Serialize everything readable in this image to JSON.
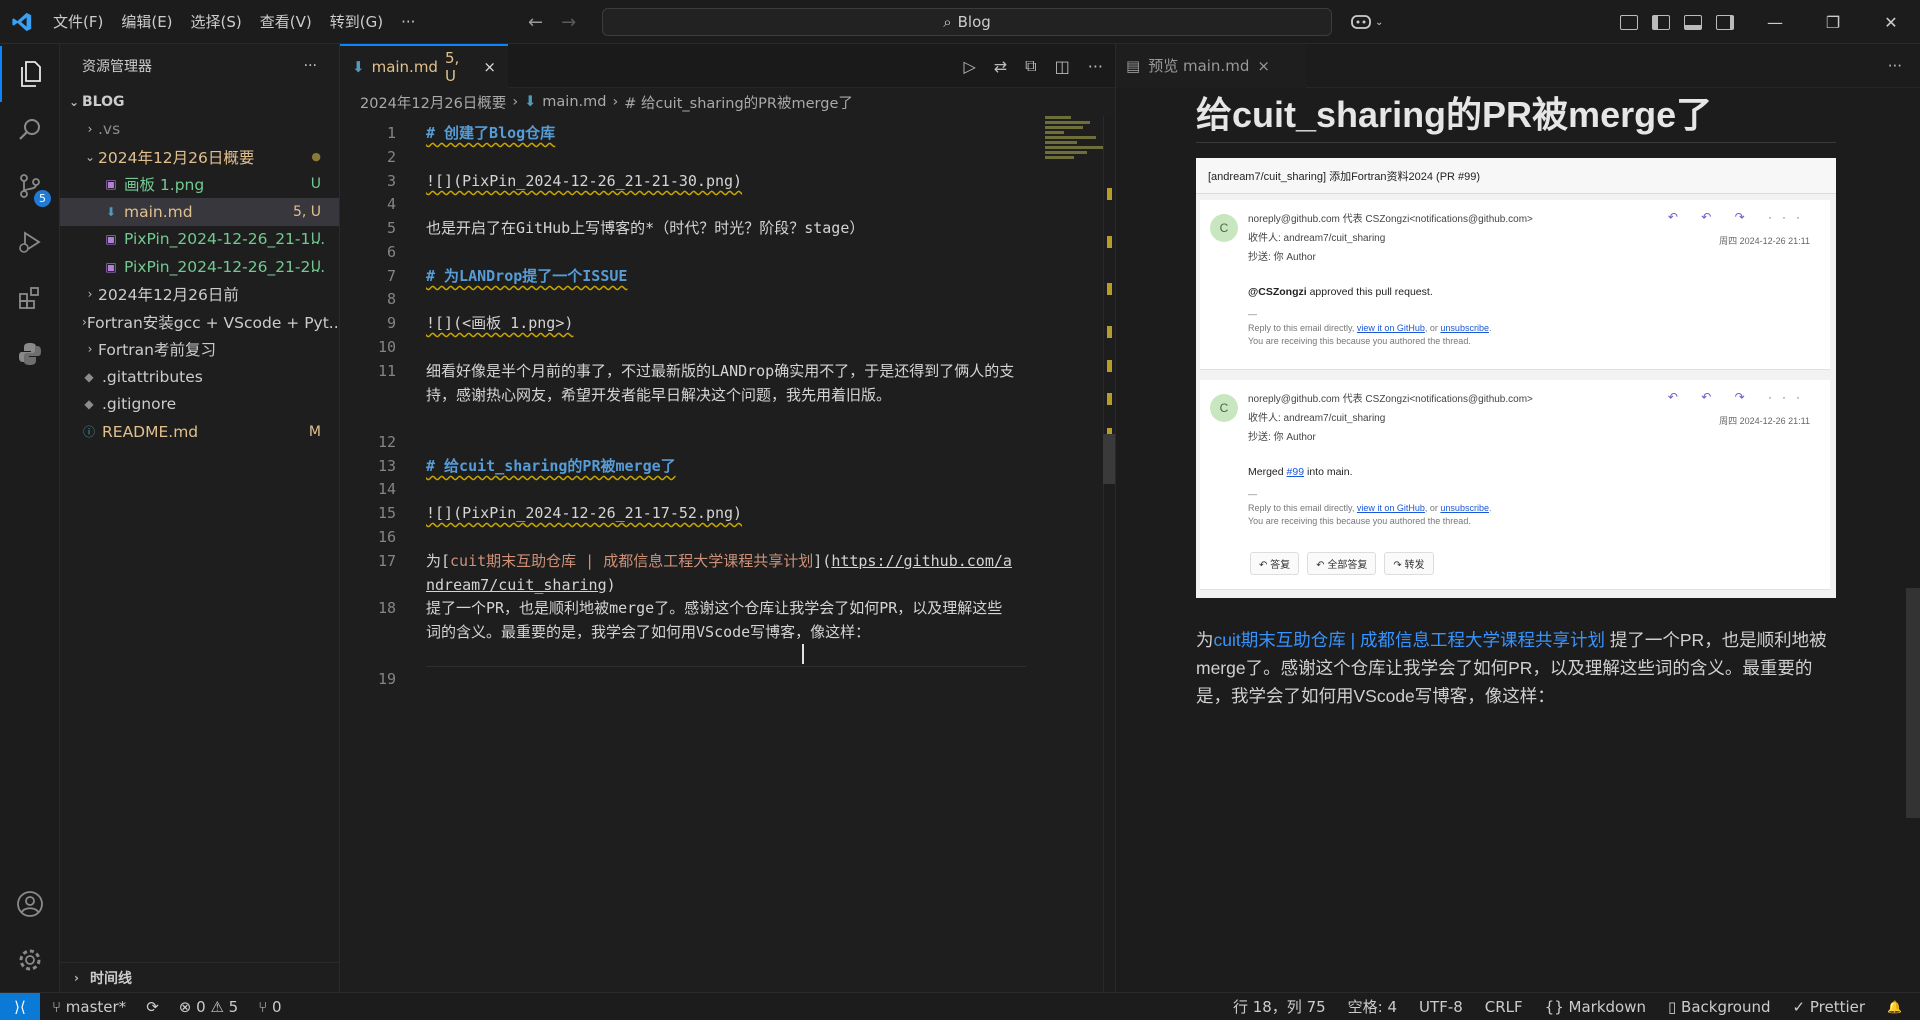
{
  "titlebar": {
    "menu": [
      "文件(F)",
      "编辑(E)",
      "选择(S)",
      "查看(V)",
      "转到(G)",
      "···"
    ],
    "search": "Blog",
    "controls": [
      "—",
      "❐",
      "✕"
    ]
  },
  "activity": {
    "badge": "5"
  },
  "sidebar": {
    "title": "资源管理器",
    "more": "···",
    "root": "BLOG",
    "items": [
      {
        "label": ".vs",
        "type": "folder",
        "status": ""
      },
      {
        "label": "2024年12月26日概要",
        "type": "folder-open",
        "status": "●"
      },
      {
        "label": "画板 1.png",
        "type": "png",
        "status": "U"
      },
      {
        "label": "main.md",
        "type": "md",
        "status": "5, U"
      },
      {
        "label": "PixPin_2024-12-26_21-1...",
        "type": "png",
        "status": "U"
      },
      {
        "label": "PixPin_2024-12-26_21-2...",
        "type": "png",
        "status": "U"
      },
      {
        "label": "2024年12月26日前",
        "type": "folder",
        "status": ""
      },
      {
        "label": "Fortran安装gcc + VScode + Pyt...",
        "type": "folder",
        "status": ""
      },
      {
        "label": "Fortran考前复习",
        "type": "folder",
        "status": ""
      },
      {
        "label": ".gitattributes",
        "type": "file",
        "status": ""
      },
      {
        "label": ".gitignore",
        "type": "file",
        "status": ""
      },
      {
        "label": "README.md",
        "type": "info",
        "status": "M"
      }
    ],
    "timeline": "时间线"
  },
  "editor": {
    "tab_label": "main.md",
    "tab_status": "5, U",
    "tab_close": "×",
    "breadcrumb": [
      "2024年12月26日概要",
      "main.md",
      "# 给cuit_sharing的PR被merge了"
    ],
    "lines": [
      {
        "n": "1",
        "text": "# 创建了Blog仓库"
      },
      {
        "n": "2",
        "text": ""
      },
      {
        "n": "3",
        "text": "![](PixPin_2024-12-26_21-21-30.png)"
      },
      {
        "n": "4",
        "text": ""
      },
      {
        "n": "5",
        "text": "也是开启了在GitHub上写博客的*（时代？时光？阶段？stage）"
      },
      {
        "n": "6",
        "text": ""
      },
      {
        "n": "7",
        "text": "# 为LANDrop提了一个ISSUE"
      },
      {
        "n": "8",
        "text": ""
      },
      {
        "n": "9",
        "text": "![](<画板 1.png>)"
      },
      {
        "n": "10",
        "text": ""
      },
      {
        "n": "11",
        "text": "细看好像是半个月前的事了，不过最新版的LANDrop确实用不了，于是还得到了俩人的支持，感谢热心网友，希望开发者能早日解决这个问题，我先用着旧版。"
      },
      {
        "n": "12",
        "text": ""
      },
      {
        "n": "13",
        "text": "# 给cuit_sharing的PR被merge了"
      },
      {
        "n": "14",
        "text": ""
      },
      {
        "n": "15",
        "text": "![](PixPin_2024-12-26_21-17-52.png)"
      },
      {
        "n": "16",
        "text": ""
      },
      {
        "n": "17",
        "text_pre": "为[",
        "text_link": "cuit期末互助仓库 | 成都信息工程大学课程共享计划",
        "text_mid": "](",
        "text_url": "https://github.com/andream7/cuit_sharing",
        "text_post": ")"
      },
      {
        "n": "18",
        "text": "提了一个PR，也是顺利地被merge了。感谢这个仓库让我学会了如何PR，以及理解这些词的含义。最重要的是，我学会了如何用VScode写博客，像这样："
      },
      {
        "n": "19",
        "text": ""
      }
    ]
  },
  "preview": {
    "tab_label": "预览 main.md",
    "tab_close": "×",
    "more": "···",
    "heading": "给cuit_sharing的PR被merge了",
    "email": {
      "subject": "[andream7/cuit_sharing] 添加Fortran资料2024 (PR #99)",
      "card1": {
        "avatar": "C",
        "from": "noreply@github.com 代表 CSZongzi<notifications@github.com>",
        "to": "收件人:  andream7/cuit_sharing",
        "cc": "抄送:  你    Author",
        "date": "周四 2024-12-26 21:11",
        "body_user": "@CSZongzi",
        "body_rest": " approved this pull request.",
        "dash": "—",
        "foot1_a": "Reply to this email directly, ",
        "foot1_link1": "view it on GitHub",
        "foot1_b": ", or ",
        "foot1_link2": "unsubscribe",
        "foot1_c": ".",
        "foot2": "You are receiving this because you authored the thread."
      },
      "card2": {
        "avatar": "C",
        "from": "noreply@github.com 代表 CSZongzi<notifications@github.com>",
        "to": "收件人:  andream7/cuit_sharing",
        "cc": "抄送:  你    Author",
        "date": "周四 2024-12-26 21:11",
        "body_a": "Merged ",
        "body_link": "#99",
        "body_b": " into main.",
        "dash": "—",
        "foot1_a": "Reply to this email directly, ",
        "foot1_link1": "view it on GitHub",
        "foot1_b": ", or ",
        "foot1_link2": "unsubscribe",
        "foot1_c": ".",
        "foot2": "You are receiving this because you authored the thread."
      },
      "actions": [
        "↶ ↶ ↷ ···"
      ],
      "reply_buttons": [
        "↶ 答复",
        "↶ 全部答复",
        "↷ 转发"
      ]
    },
    "para_pre": "为",
    "para_link": "cuit期末互助仓库 | 成都信息工程大学课程共享计划",
    "para_post": " 提了一个PR，也是顺利地被merge了。感谢这个仓库让我学会了如何PR，以及理解这些词的含义。最重要的是，我学会了如何用VScode写博客，像这样："
  },
  "statusbar": {
    "branch": "master*",
    "sync": "⟳",
    "errors": "⊗ 0",
    "warnings": "⚠ 5",
    "ports": "⑂ 0",
    "position": "行 18，列 75",
    "spaces": "空格: 4",
    "encoding": "UTF-8",
    "eol": "CRLF",
    "language": "Markdown",
    "background": "Background",
    "prettier": "✓ Prettier",
    "bell": "🔔"
  }
}
